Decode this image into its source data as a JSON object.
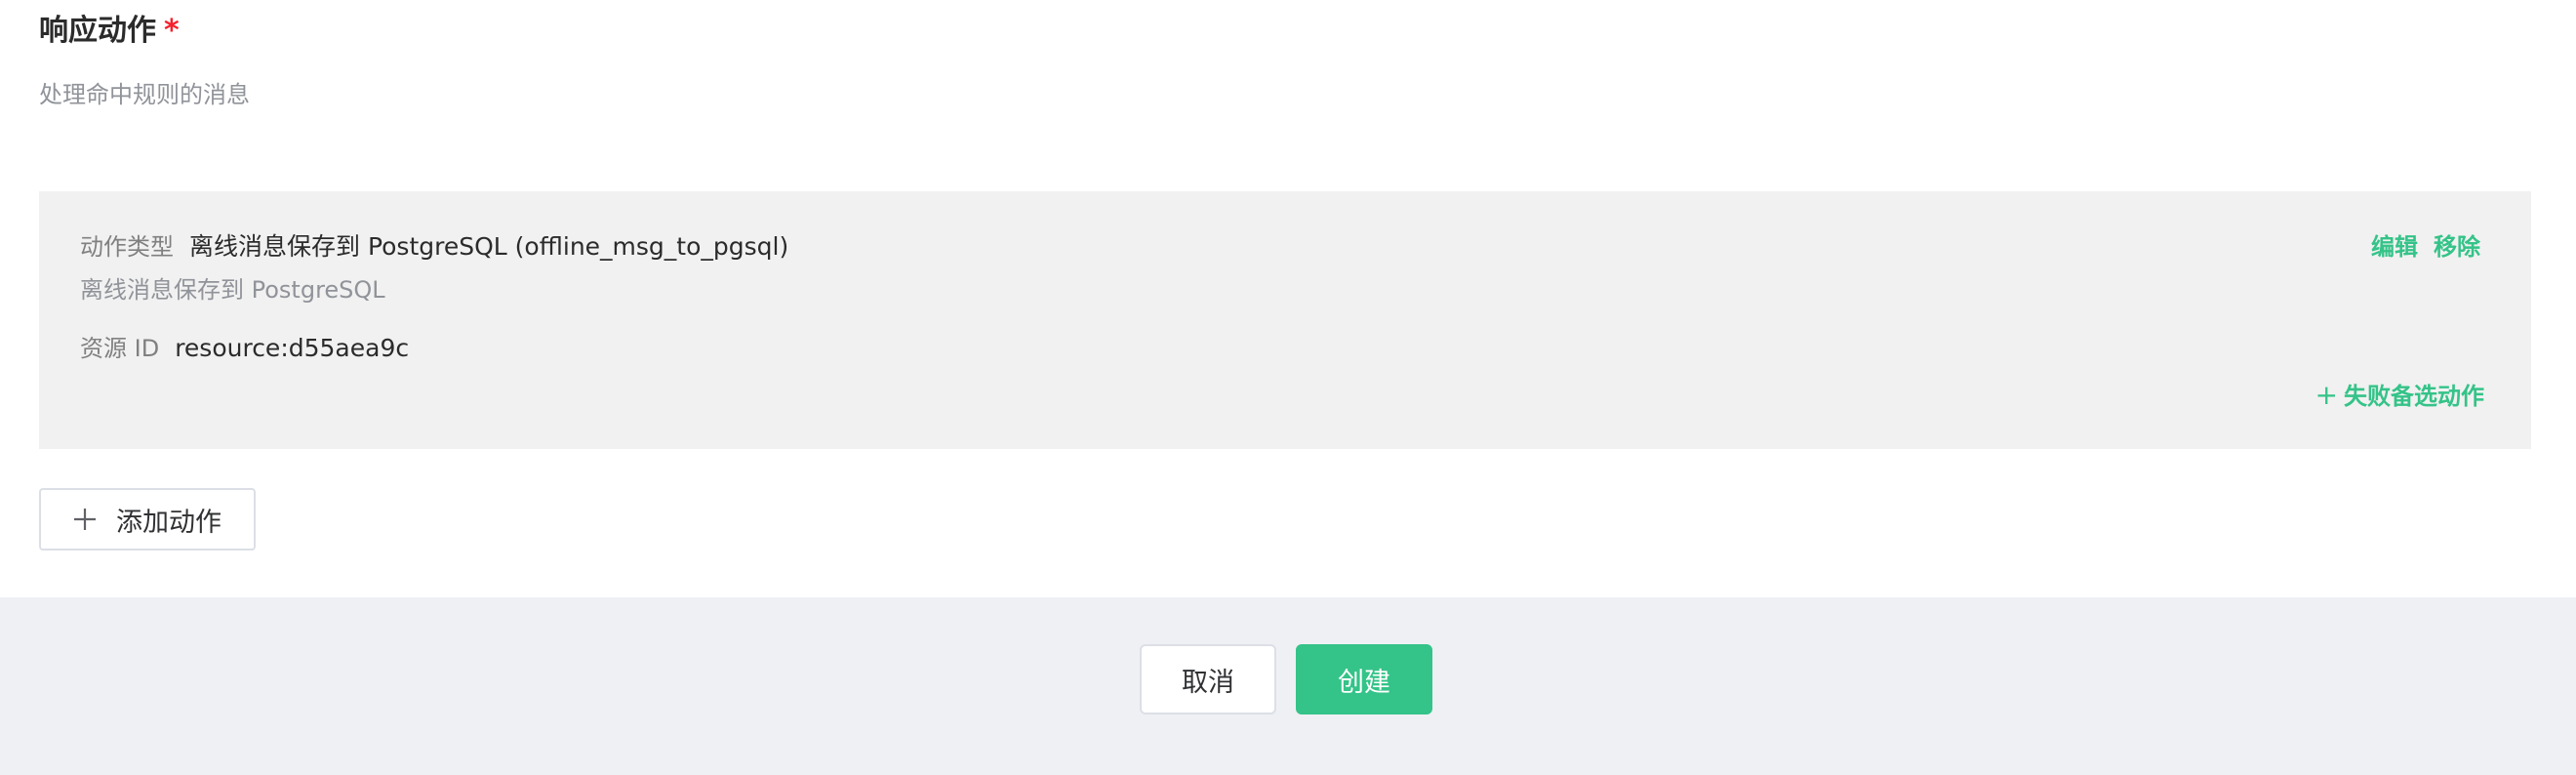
{
  "section": {
    "title": "响应动作",
    "required_mark": "*",
    "description": "处理命中规则的消息"
  },
  "action_card": {
    "type_label": "动作类型",
    "type_value": "离线消息保存到 PostgreSQL (offline_msg_to_pgsql)",
    "type_description": "离线消息保存到 PostgreSQL",
    "resource_label": "资源 ID",
    "resource_value": "resource:d55aea9c",
    "edit_label": "编辑",
    "remove_label": "移除",
    "fallback_plus": "+",
    "fallback_label": "失败备选动作"
  },
  "add_action": {
    "label": "添加动作",
    "icon": "plus-icon"
  },
  "footer": {
    "cancel_label": "取消",
    "create_label": "创建"
  },
  "colors": {
    "accent": "#34c388",
    "required": "#f5222d",
    "card_bg": "#f1f1f1",
    "footer_bg": "#eff0f4"
  }
}
